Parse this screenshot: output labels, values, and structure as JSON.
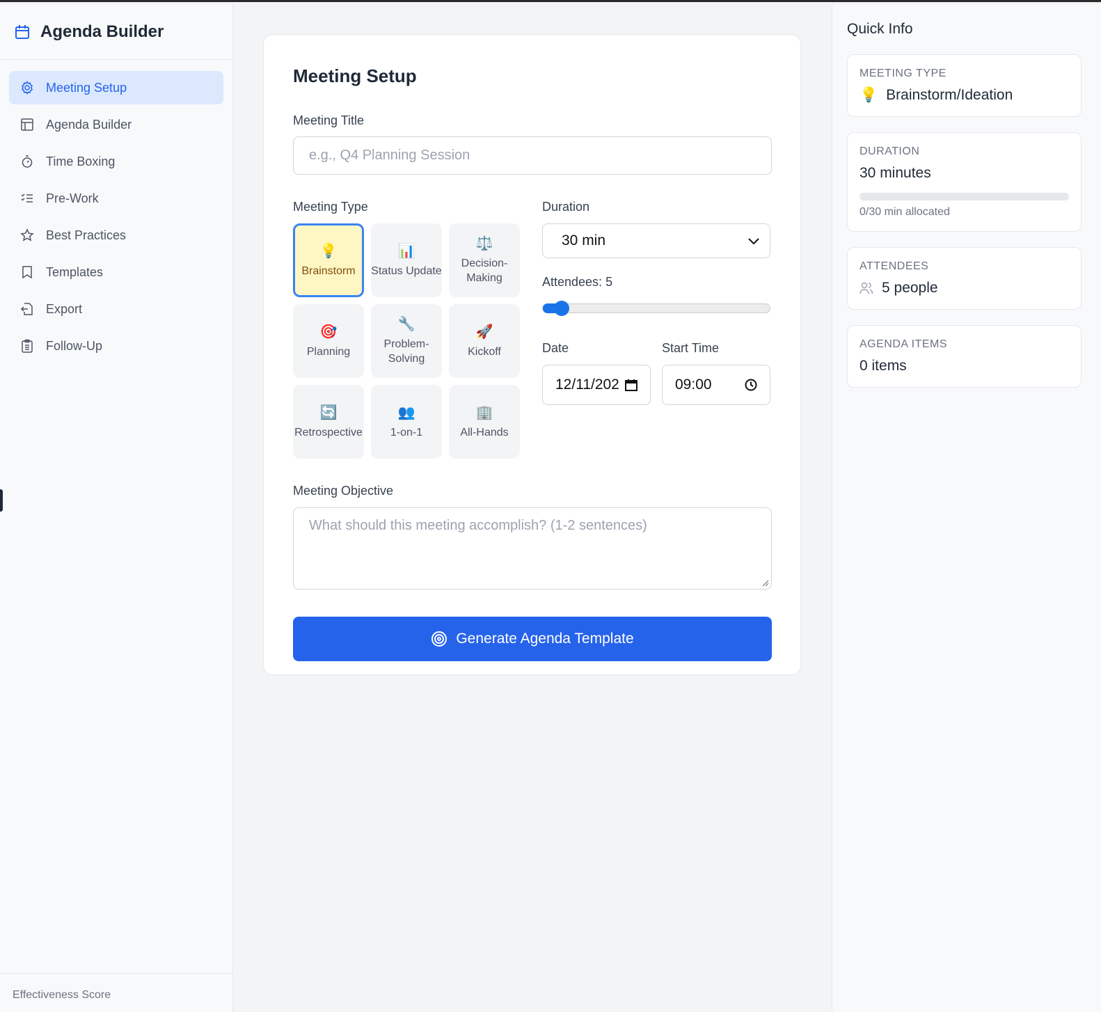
{
  "app": {
    "title": "Agenda Builder"
  },
  "sidebar": {
    "items": [
      {
        "label": "Meeting Setup",
        "icon": "gear-icon",
        "active": true
      },
      {
        "label": "Agenda Builder",
        "icon": "layout-icon"
      },
      {
        "label": "Time Boxing",
        "icon": "timer-icon"
      },
      {
        "label": "Pre-Work",
        "icon": "checklist-icon"
      },
      {
        "label": "Best Practices",
        "icon": "star-icon"
      },
      {
        "label": "Templates",
        "icon": "bookmark-icon"
      },
      {
        "label": "Export",
        "icon": "export-icon"
      },
      {
        "label": "Follow-Up",
        "icon": "clipboard-icon"
      }
    ],
    "footer": "Effectiveness Score"
  },
  "form": {
    "heading": "Meeting Setup",
    "title_label": "Meeting Title",
    "title_placeholder": "e.g., Q4 Planning Session",
    "type_label": "Meeting Type",
    "types": [
      {
        "emoji": "💡",
        "label": "Brainstorm",
        "selected": true
      },
      {
        "emoji": "📊",
        "label": "Status Update"
      },
      {
        "emoji": "⚖️",
        "label": "Decision-Making"
      },
      {
        "emoji": "🎯",
        "label": "Planning"
      },
      {
        "emoji": "🔧",
        "label": "Problem-Solving"
      },
      {
        "emoji": "🚀",
        "label": "Kickoff"
      },
      {
        "emoji": "🔄",
        "label": "Retrospective"
      },
      {
        "emoji": "👥",
        "label": "1-on-1"
      },
      {
        "emoji": "🏢",
        "label": "All-Hands"
      }
    ],
    "duration_label": "Duration",
    "duration_value": "30 min",
    "attendees_label": "Attendees: 5",
    "attendees_value": 5,
    "attendees_min": 1,
    "attendees_max": 50,
    "date_label": "Date",
    "date_value": "12/11/202",
    "time_label": "Start Time",
    "time_value": "09:00",
    "objective_label": "Meeting Objective",
    "objective_placeholder": "What should this meeting accomplish? (1-2 sentences)",
    "generate_label": "Generate Agenda Template"
  },
  "quick": {
    "heading": "Quick Info",
    "type_key": "MEETING TYPE",
    "type_emoji": "💡",
    "type_value": "Brainstorm/Ideation",
    "duration_key": "DURATION",
    "duration_value": "30 minutes",
    "allocated_fraction": 0,
    "allocated_text": "0/30 min allocated",
    "attendees_key": "ATTENDEES",
    "attendees_value": "5 people",
    "items_key": "AGENDA ITEMS",
    "items_value": "0 items"
  },
  "colors": {
    "accent": "#2563eb",
    "selected_bg": "#fef7c3"
  }
}
